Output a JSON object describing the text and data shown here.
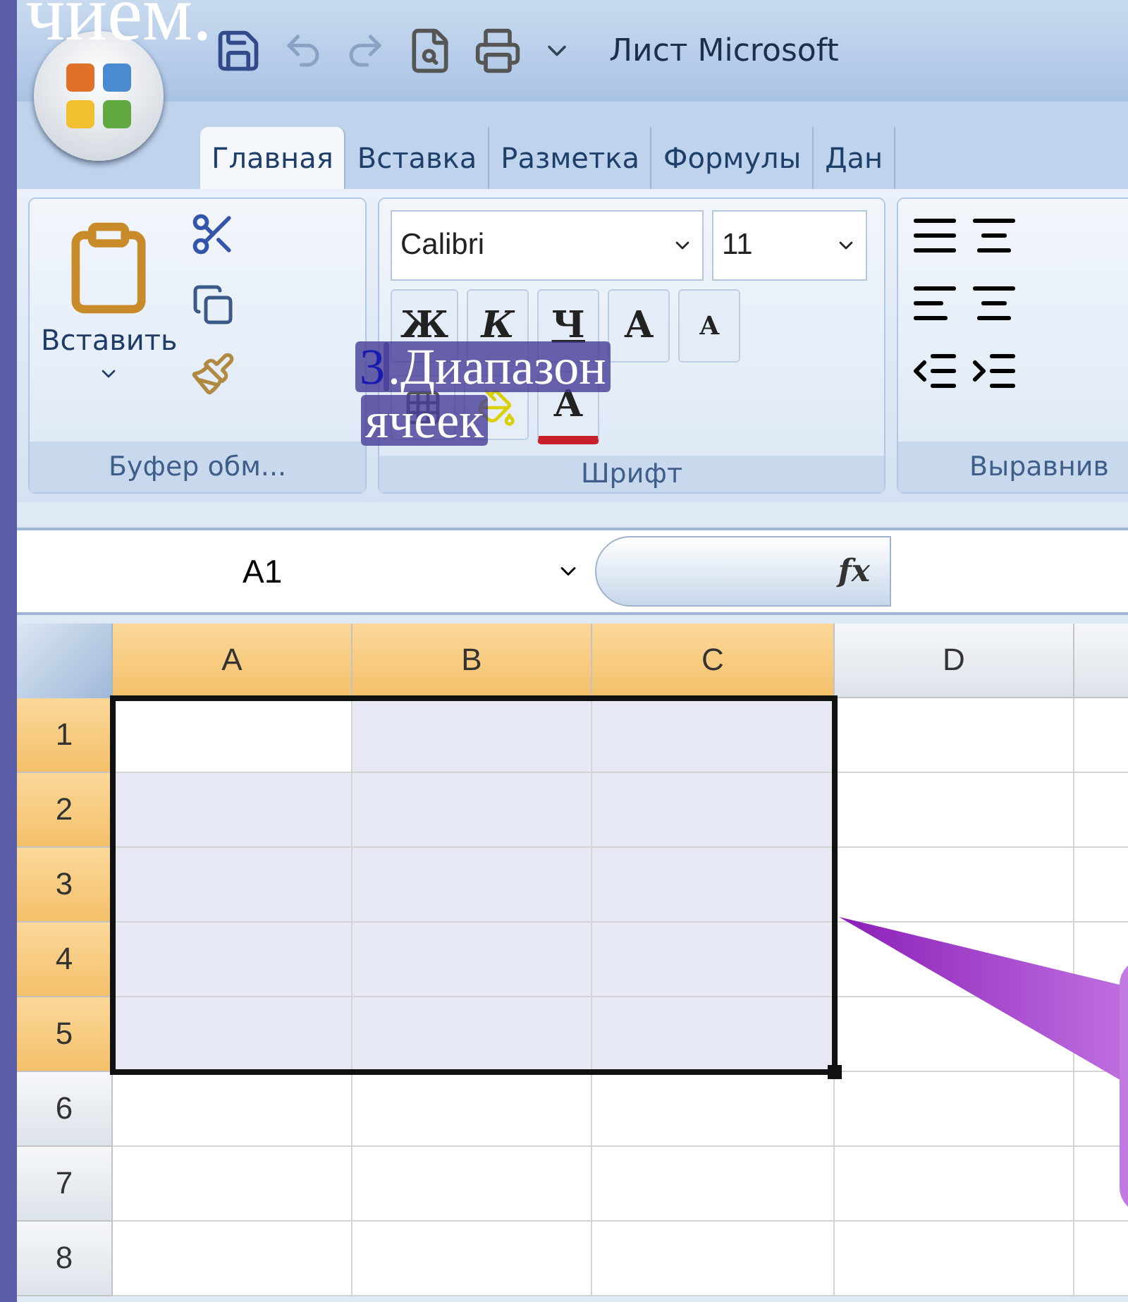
{
  "slide_title": "чием.",
  "window": {
    "title": "Лист Microsoft"
  },
  "tabs": [
    {
      "label": "Главная",
      "selected": true
    },
    {
      "label": "Вставка",
      "selected": false
    },
    {
      "label": "Разметка",
      "selected": false
    },
    {
      "label": "Формулы",
      "selected": false
    },
    {
      "label": "Дан",
      "selected": false
    }
  ],
  "clipboard_group": {
    "paste_label": "Вставить",
    "label": "Буфер обм..."
  },
  "font_group": {
    "font_name": "Calibri",
    "font_size": "11",
    "bold": "Ж",
    "italic": "К",
    "underline": "Ч",
    "grow": "A",
    "shrink": "A",
    "font_color": "A",
    "label": "Шрифт"
  },
  "alignment_group": {
    "label": "Выравнив"
  },
  "caption": {
    "number": "3",
    "line_1": ".Диапазон",
    "line_2": "ячеек"
  },
  "formula_bar": {
    "name_box": "A1",
    "fx": "fx"
  },
  "columns": [
    {
      "label": "A",
      "selected": true
    },
    {
      "label": "B",
      "selected": true
    },
    {
      "label": "C",
      "selected": true
    },
    {
      "label": "D",
      "selected": false
    }
  ],
  "rows": [
    {
      "label": "1",
      "selected": true
    },
    {
      "label": "2",
      "selected": true
    },
    {
      "label": "3",
      "selected": true
    },
    {
      "label": "4",
      "selected": true
    },
    {
      "label": "5",
      "selected": true
    },
    {
      "label": "6",
      "selected": false
    },
    {
      "label": "7",
      "selected": false
    },
    {
      "label": "8",
      "selected": false
    }
  ]
}
